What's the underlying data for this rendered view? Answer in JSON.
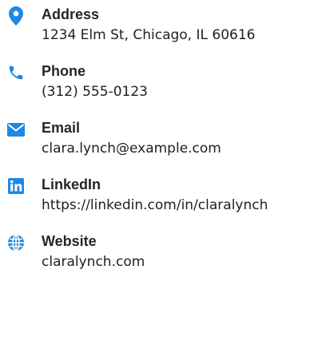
{
  "contacts": {
    "address": {
      "label": "Address",
      "value": "1234 Elm St, Chicago, IL 60616",
      "icon": "map-marker-icon"
    },
    "phone": {
      "label": "Phone",
      "value": "(312) 555-0123",
      "icon": "phone-icon"
    },
    "email": {
      "label": "Email",
      "value": "clara.lynch@example.com",
      "icon": "envelope-icon"
    },
    "linkedin": {
      "label": "LinkedIn",
      "value": "https://linkedin.com/in/claralynch",
      "icon": "linkedin-icon"
    },
    "website": {
      "label": "Website",
      "value": "claralynch.com",
      "icon": "globe-icon"
    }
  },
  "colors": {
    "icon_blue": "#1E88E5",
    "label_text": "#262626",
    "value_text": "#1f1f1f"
  }
}
